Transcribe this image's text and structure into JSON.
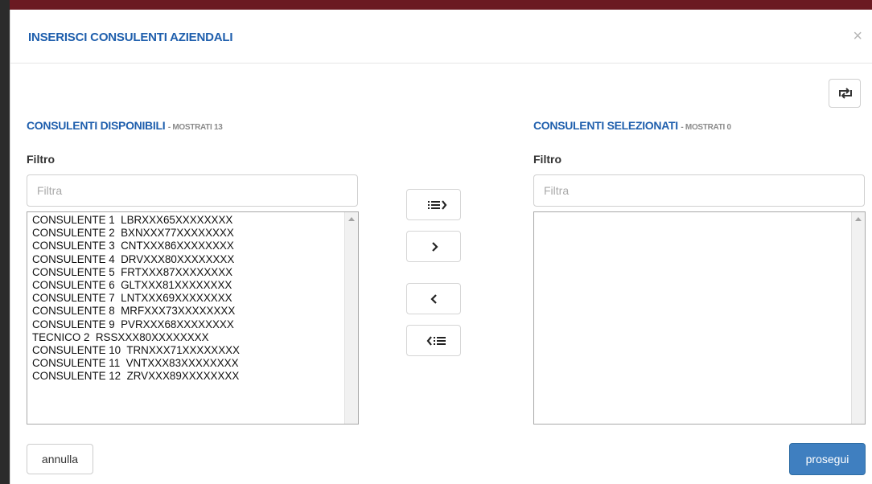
{
  "modal": {
    "title": "INSERISCI CONSULENTI AZIENDALI",
    "close_glyph": "×"
  },
  "available": {
    "title": "CONSULENTI DISPONIBILI",
    "count_text": "- MOSTRATI 13",
    "filter_label": "Filtro",
    "filter_placeholder": "Filtra",
    "items": [
      "CONSULENTE 1  LBRXXX65XXXXXXXX",
      "CONSULENTE 2  BXNXXX77XXXXXXXX",
      "CONSULENTE 3  CNTXXX86XXXXXXXX",
      "CONSULENTE 4  DRVXXX80XXXXXXXX",
      "CONSULENTE 5  FRTXXX87XXXXXXXX",
      "CONSULENTE 6  GLTXXX81XXXXXXXX",
      "CONSULENTE 7  LNTXXX69XXXXXXXX",
      "CONSULENTE 8  MRFXXX73XXXXXXXX",
      "CONSULENTE 9  PVRXXX68XXXXXXXX",
      "TECNICO 2  RSSXXX80XXXXXXXX",
      "CONSULENTE 10  TRNXXX71XXXXXXXX",
      "CONSULENTE 11  VNTXXX83XXXXXXXX",
      "CONSULENTE 12  ZRVXXX89XXXXXXXX"
    ]
  },
  "selected": {
    "title": "CONSULENTI SELEZIONATI",
    "count_text": "- MOSTRATI 0",
    "filter_label": "Filtro",
    "filter_placeholder": "Filtra",
    "items": []
  },
  "buttons": {
    "cancel_label": "annulla",
    "proceed_label": "prosegui"
  },
  "icons": {
    "swap": "swap-lists-icon",
    "move_all_right": "move-all-right-icon",
    "move_right": "chevron-right-icon",
    "move_left": "chevron-left-icon",
    "move_all_left": "move-all-left-icon"
  },
  "colors": {
    "accent": "#1f5fad",
    "primary_button": "#3f7fc0"
  }
}
